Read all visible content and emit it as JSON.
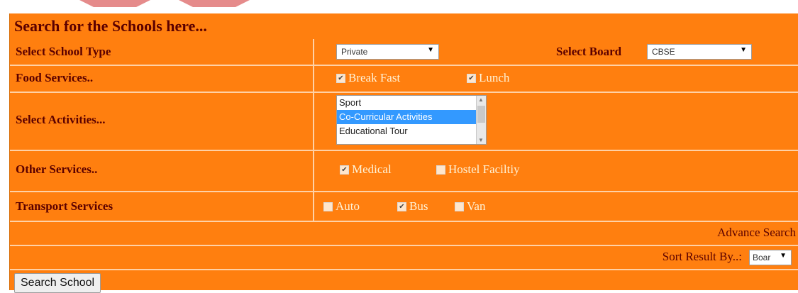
{
  "title": "Search for the Schools here...",
  "rows": {
    "school_type": {
      "label": "Select School  Type",
      "value": "Private"
    },
    "board": {
      "label": "Select Board",
      "value": "CBSE"
    },
    "food": {
      "label": "Food Services..",
      "options": [
        {
          "label": "Break Fast",
          "checked": true
        },
        {
          "label": "Lunch",
          "checked": true
        }
      ]
    },
    "activities": {
      "label": "Select Activities...",
      "options": [
        "Sport",
        "Co-Curricular Activities",
        "Educational Tour"
      ],
      "selected": "Co-Curricular Activities"
    },
    "other": {
      "label": "Other Services..",
      "options": [
        {
          "label": "Medical",
          "checked": true
        },
        {
          "label": "Hostel Faciltiy",
          "checked": false
        }
      ]
    },
    "transport": {
      "label": "Transport Services",
      "options": [
        {
          "label": "Auto",
          "checked": false
        },
        {
          "label": "Bus",
          "checked": true
        },
        {
          "label": "Van",
          "checked": false
        }
      ]
    }
  },
  "advance_search": "Advance Search",
  "sort": {
    "label": "Sort Result By..:",
    "value": "Boar"
  },
  "button": "Search School",
  "colors": {
    "background": "#ff7f0f",
    "text": "#5b0000",
    "divider": "#ffd1a6"
  }
}
